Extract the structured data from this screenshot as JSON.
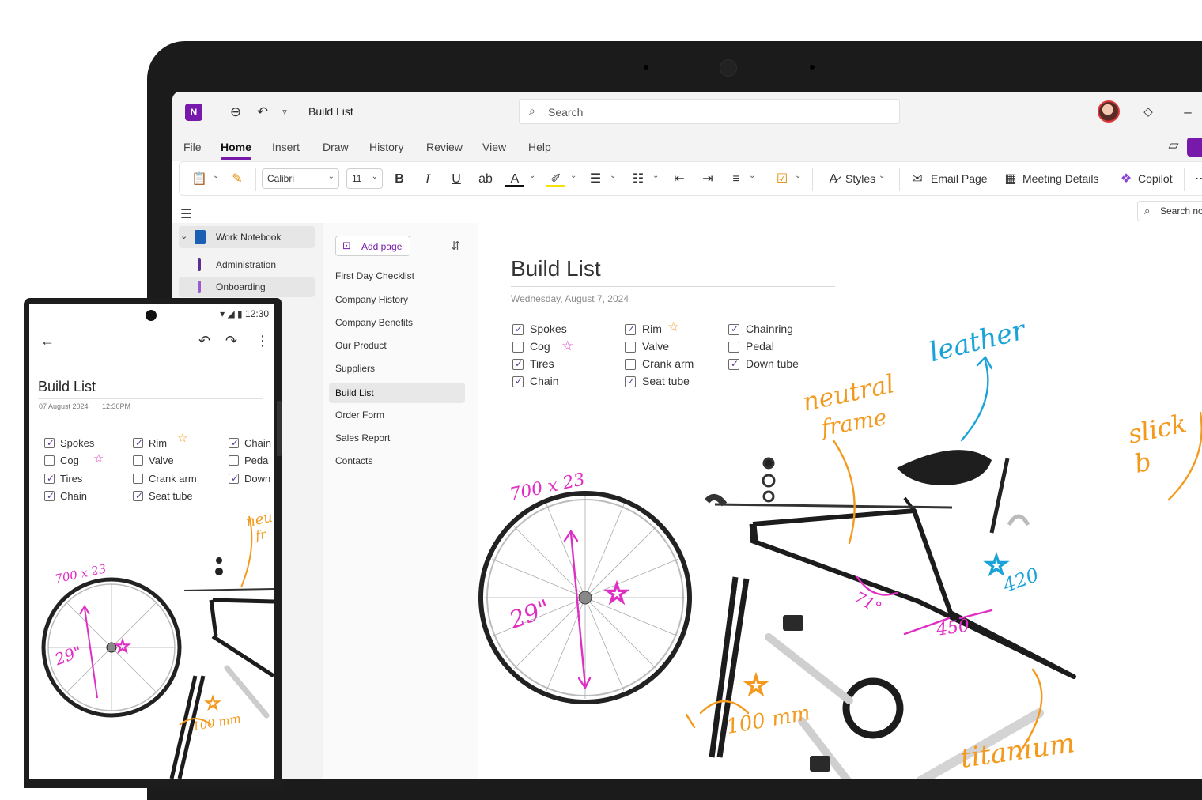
{
  "app": {
    "window_title": "Build List",
    "search_placeholder": "Search",
    "menu_tabs": [
      "File",
      "Home",
      "Insert",
      "Draw",
      "History",
      "Review",
      "View",
      "Help"
    ],
    "active_tab": "Home",
    "ribbon": {
      "font_name": "Calibri",
      "font_size": "11",
      "styles_label": "Styles",
      "email_page_label": "Email Page",
      "meeting_details_label": "Meeting Details",
      "copilot_label": "Copilot"
    },
    "search_notes_placeholder": "Search no"
  },
  "notebook": {
    "name": "Work Notebook",
    "sections": [
      {
        "label": "Administration",
        "color": "#5b2d8f"
      },
      {
        "label": "Onboarding",
        "color": "#9b59d0"
      }
    ]
  },
  "pages": {
    "add_page_label": "Add page",
    "items": [
      "First Day Checklist",
      "Company History",
      "Company Benefits",
      "Our Product",
      "Suppliers",
      "Build List",
      "Order Form",
      "Sales Report",
      "Contacts"
    ],
    "active": "Build List"
  },
  "page": {
    "title": "Build List",
    "date": "Wednesday, August 7, 2024",
    "checklist": [
      [
        {
          "label": "Spokes",
          "checked": true
        },
        {
          "label": "Cog",
          "checked": false,
          "star": "pink"
        },
        {
          "label": "Tires",
          "checked": true
        },
        {
          "label": "Chain",
          "checked": true
        }
      ],
      [
        {
          "label": "Rim",
          "checked": true,
          "star": "orange"
        },
        {
          "label": "Valve",
          "checked": false
        },
        {
          "label": "Crank arm",
          "checked": false
        },
        {
          "label": "Seat tube",
          "checked": true
        }
      ],
      [
        {
          "label": "Chainring",
          "checked": true
        },
        {
          "label": "Pedal",
          "checked": false
        },
        {
          "label": "Down tube",
          "checked": true
        }
      ]
    ],
    "ink_annotations": {
      "leather": "leather",
      "neutral": "neutral",
      "frame": "frame",
      "wheel_size": "700 x 23",
      "wheel_diameter": "29\"",
      "angle": "71°",
      "tube_450": "450",
      "tube_420": "420",
      "crank": "100 mm",
      "titanium": "titanium",
      "slick": "slick b"
    },
    "colors": {
      "accent": "#7719aa",
      "ink_orange": "#f39a1e",
      "ink_blue": "#1aa3d8",
      "ink_pink": "#e02ec4"
    }
  },
  "phone": {
    "time": "12:30",
    "title": "Build List",
    "date": "07 August 2024",
    "time_label": "12:30PM",
    "checklist": [
      [
        {
          "label": "Spokes",
          "checked": true
        },
        {
          "label": "Cog",
          "checked": false,
          "star": "pink"
        },
        {
          "label": "Tires",
          "checked": true
        },
        {
          "label": "Chain",
          "checked": true
        }
      ],
      [
        {
          "label": "Rim",
          "checked": true,
          "star": "orange"
        },
        {
          "label": "Valve",
          "checked": false
        },
        {
          "label": "Crank arm",
          "checked": false
        },
        {
          "label": "Seat tube",
          "checked": true
        }
      ],
      [
        {
          "label": "Chain",
          "checked": true
        },
        {
          "label": "Peda",
          "checked": false
        },
        {
          "label": "Down",
          "checked": true
        }
      ]
    ],
    "ink_annotations": {
      "wheel_size": "700 x 23",
      "wheel_diameter": "29\"",
      "neutral": "neu",
      "frame": "fr",
      "crank": "100 mm"
    }
  }
}
